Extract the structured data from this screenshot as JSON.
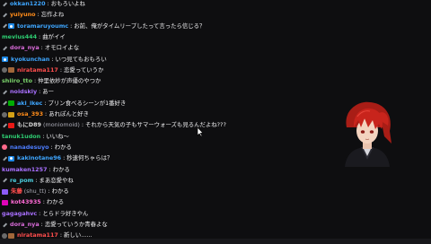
{
  "messages": [
    {
      "badges": [
        "tool"
      ],
      "name": "okkan1220",
      "name_color": "#3ea6ff",
      "sep": ":",
      "text": "おもろいよね"
    },
    {
      "badges": [
        "tool"
      ],
      "name": "yuiyuno",
      "name_color": "#ff8c1a",
      "sep": ":",
      "text": "忘作よね"
    },
    {
      "badges": [
        "tool",
        "sub"
      ],
      "name": "toramaruyoumc",
      "name_color": "#3ea6ff",
      "sep": ":",
      "text": "お前、俺がタイムリープしたって言ったら信じる？"
    },
    {
      "badges": [],
      "name": "mevius444",
      "name_color": "#2ecc71",
      "sep": ":",
      "text": "曲がイイ"
    },
    {
      "badges": [
        "tool"
      ],
      "name": "dora_nya",
      "name_color": "#d86bd8",
      "sep": ":",
      "text": "オモロイよな"
    },
    {
      "badges": [
        "sub"
      ],
      "name": "kyokunchan",
      "name_color": "#3ea6ff",
      "sep": ":",
      "text": "いつ見てもおもろい"
    },
    {
      "badges": [
        "mask",
        "bits"
      ],
      "name": "niratama117",
      "name_color": "#ff4d4d",
      "sep": ":",
      "text": "恋愛っていうか"
    },
    {
      "badges": [],
      "name": "shiiro_tto",
      "name_color": "#7bd36b",
      "sep": ":",
      "text": "仲里依紗が声優のやつか"
    },
    {
      "badges": [
        "tool"
      ],
      "name": "noidskiy",
      "name_color": "#a970ff",
      "sep": ":",
      "text": "あー"
    },
    {
      "badges": [
        "tool",
        "mod"
      ],
      "name": "aki_ikec",
      "name_color": "#3ea6ff",
      "sep": ":",
      "text": "プリン食べるシーンが1番好き"
    },
    {
      "badges": [
        "mask",
        "star"
      ],
      "name": "osa_393",
      "name_color": "#ff8c1a",
      "sep": ":",
      "text": "あれぽんと好き"
    },
    {
      "badges": [
        "tool",
        "gift"
      ],
      "name": "もにD89",
      "name_color": "#d8d8d8",
      "sep": "",
      "sub_name": "(moniomoid)",
      "text": ": それから天気の子もサマーウォーズも見るんだよね???"
    },
    {
      "badges": [],
      "name": "tanuk1udon",
      "name_color": "#2ecc71",
      "sep": ":",
      "text": "いいね～"
    },
    {
      "badges": [
        "heart"
      ],
      "name": "nanadesuyo",
      "name_color": "#4d7dff",
      "sep": ":",
      "text": "わかる"
    },
    {
      "badges": [
        "tool",
        "sub"
      ],
      "name": "kakinotane96",
      "name_color": "#3ea6ff",
      "sep": ":",
      "text": "秒速何ちゃらは？"
    },
    {
      "badges": [],
      "name": "kumaken1257",
      "name_color": "#a970ff",
      "sep": ":",
      "text": "わかる"
    },
    {
      "badges": [
        "tool"
      ],
      "name": "re_pom",
      "name_color": "#4dd0e1",
      "sep": ":",
      "text": "まあ恋愛やね"
    },
    {
      "badges": [
        "purple"
      ],
      "name": "朱藤",
      "name_color": "#ff4d4d",
      "sep": "",
      "sub_name": "(shu_tt)",
      "text": ": わかる"
    },
    {
      "badges": [
        "vip"
      ],
      "name": "kot43935",
      "name_color": "#ff6ad5",
      "sep": ":",
      "text": "わかる"
    },
    {
      "badges": [],
      "name": "gagagahvc",
      "name_color": "#a970ff",
      "sep": ":",
      "text": "とらドラ好きやん"
    },
    {
      "badges": [
        "tool"
      ],
      "name": "dora_nya",
      "name_color": "#d86bd8",
      "sep": ":",
      "text": "恋愛っていうか青春よな"
    },
    {
      "badges": [
        "mask",
        "bits"
      ],
      "name": "niratama117",
      "name_color": "#ff4d4d",
      "sep": ":",
      "text": "新しい......"
    }
  ],
  "colors": {
    "background": "#0e0e10",
    "text": "#efeff1",
    "hair": "#c8241c",
    "jacket": "#1a1a1f"
  },
  "icons": [
    "wrench-icon",
    "subscriber-icon",
    "bits-icon",
    "moderator-icon",
    "gift-icon",
    "vip-icon",
    "cursor-icon"
  ]
}
